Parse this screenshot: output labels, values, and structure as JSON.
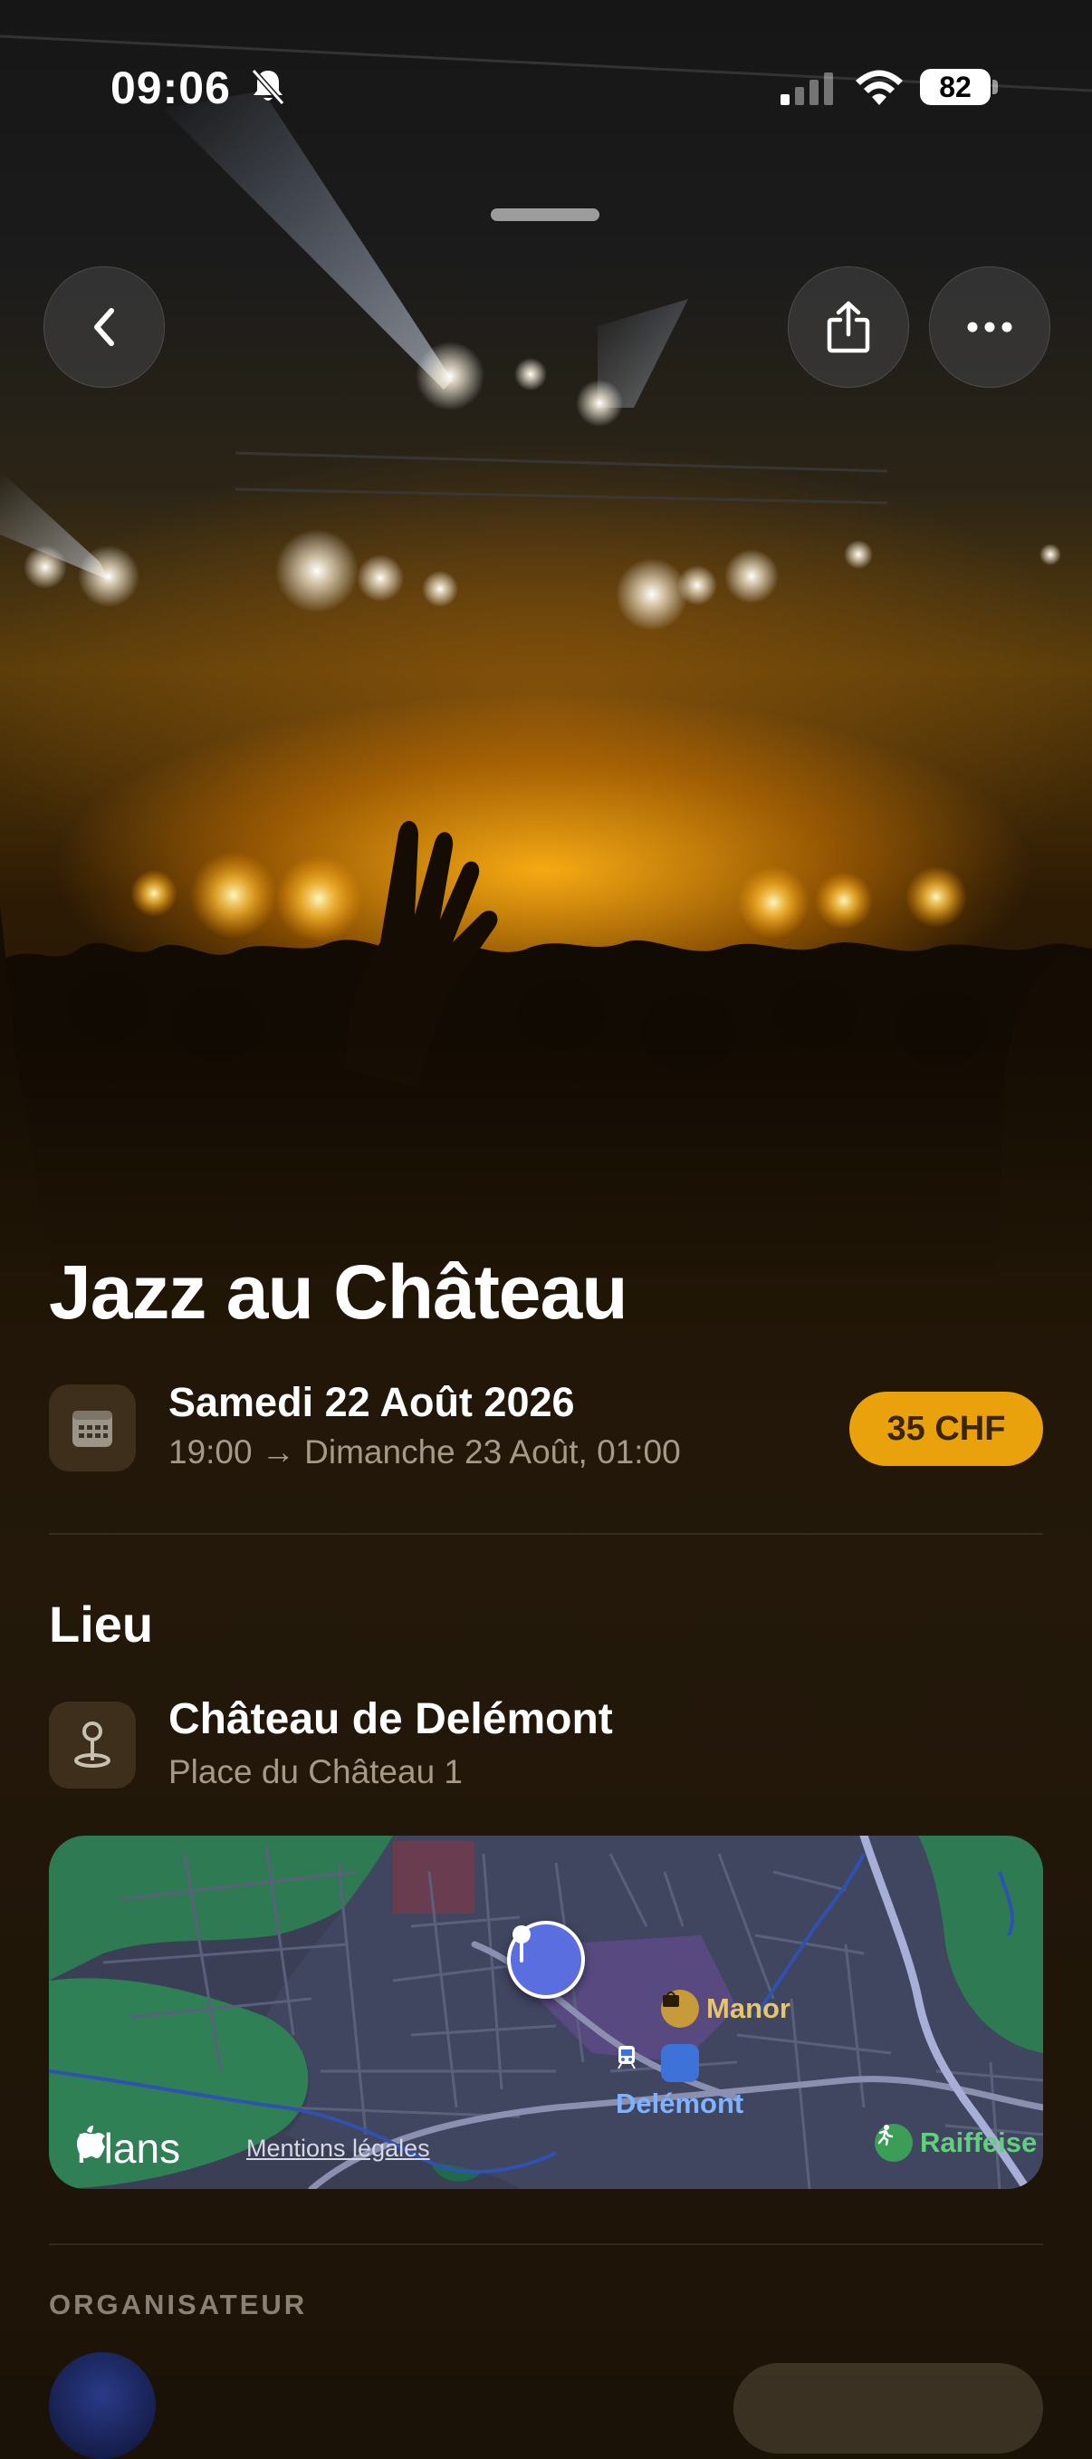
{
  "status_bar": {
    "time": "09:06",
    "battery": "82",
    "icons": [
      "bell-slash-icon",
      "cellular-signal-icon",
      "wifi-icon",
      "battery-icon"
    ]
  },
  "header": {
    "back_icon": "chevron-left-icon",
    "share_icon": "share-icon",
    "more_icon": "ellipsis-icon"
  },
  "event": {
    "title": "Jazz au Château",
    "date_main": "Samedi 22 Août 2026",
    "date_sub": "19:00 → Dimanche 23 Août, 01:00",
    "price": "35 CHF",
    "date_icon": "calendar-icon"
  },
  "venue": {
    "section_title": "Lieu",
    "name": "Château de Delémont",
    "address": "Place du Château 1",
    "icon": "map-pin-icon"
  },
  "map": {
    "brand": "Plans",
    "legal": "Mentions légales",
    "pois": {
      "manor": "Manor",
      "station": "Delémont",
      "raiffeisen": "Raiffeise"
    },
    "colors": {
      "pin": "#5b6ee0",
      "manor": "#e8c46a",
      "station": "#7fb2ff",
      "raiffeisen": "#5fd17a"
    }
  },
  "organizer": {
    "label": "ORGANISATEUR"
  },
  "colors": {
    "accent": "#e9a20c",
    "background": "#1a1206"
  }
}
